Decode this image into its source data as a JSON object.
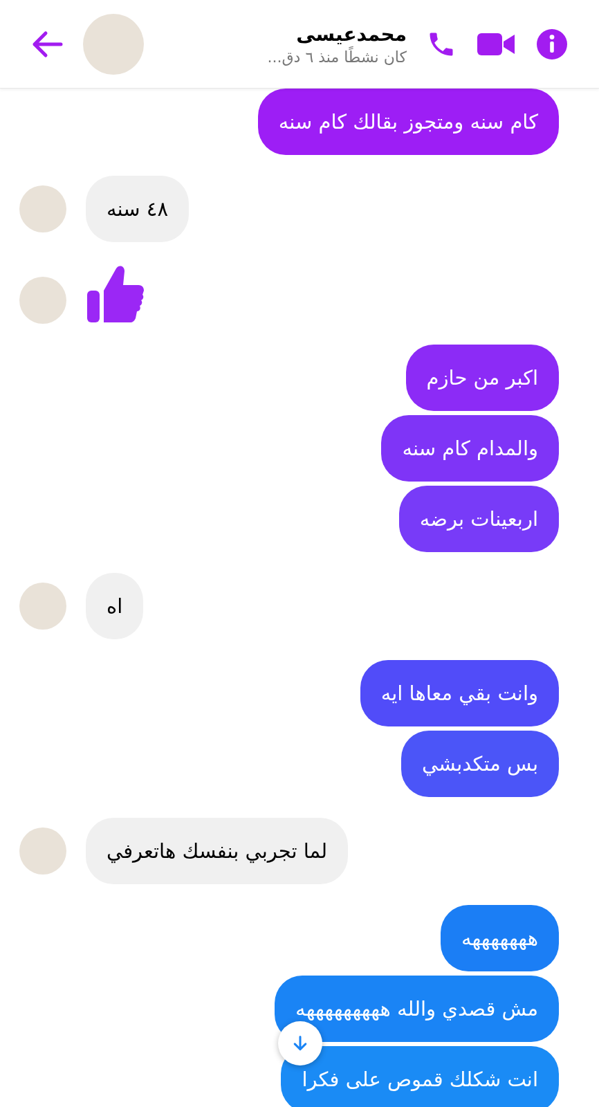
{
  "header": {
    "name": "محمدعيسى",
    "status": "كان نشطًا منذ ٦ دق..."
  },
  "messages": [
    {
      "kind": "sent",
      "text": "كام سنه ومتجوز بقالك كام سنه",
      "color": "#9d1ef5"
    },
    {
      "kind": "received",
      "text": "٤٨ سنه"
    },
    {
      "kind": "like"
    },
    {
      "kind": "sent",
      "text": "اكبر من حازم",
      "color": "#8c2bf6"
    },
    {
      "kind": "sent",
      "text": "والمدام كام سنه",
      "color": "#7f34f7"
    },
    {
      "kind": "sent",
      "text": "اربعينات برضه",
      "color": "#783bf8"
    },
    {
      "kind": "received",
      "text": "اه"
    },
    {
      "kind": "sent",
      "text": "وانت بقي معاها ايه",
      "color": "#514cf9"
    },
    {
      "kind": "sent",
      "text": "بس متكدبشي",
      "color": "#4b55f8"
    },
    {
      "kind": "received",
      "text": "لما تجربي بنفسك هاتعرفي"
    },
    {
      "kind": "sent",
      "text": "هههههههه",
      "color": "#1b7ef5"
    },
    {
      "kind": "sent",
      "text": "مش قصدي والله هههههههههه",
      "color": "#1a84f5"
    },
    {
      "kind": "sent",
      "text": "انت شكلك قموص على فكرا",
      "color": "#1a8bf5"
    }
  ]
}
